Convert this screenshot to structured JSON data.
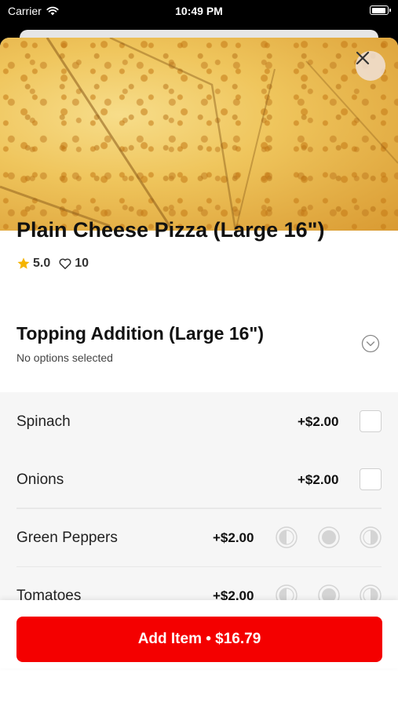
{
  "status_bar": {
    "carrier": "Carrier",
    "time": "10:49 PM"
  },
  "item": {
    "title": "Plain Cheese Pizza (Large 16\")",
    "rating": "5.0",
    "likes": "10"
  },
  "section": {
    "title": "Topping Addition (Large 16\")",
    "subtitle": "No options selected"
  },
  "options": [
    {
      "name": "Spinach",
      "price": "+$2.00",
      "control": "checkbox"
    },
    {
      "name": "Onions",
      "price": "+$2.00",
      "control": "checkbox"
    },
    {
      "name": "Green Peppers",
      "price": "+$2.00",
      "control": "portion"
    },
    {
      "name": "Tomatoes",
      "price": "+$2.00",
      "control": "portion"
    }
  ],
  "footer": {
    "add_label": "Add Item • $16.79"
  },
  "colors": {
    "accent": "#f40000",
    "star": "#f5b400"
  }
}
